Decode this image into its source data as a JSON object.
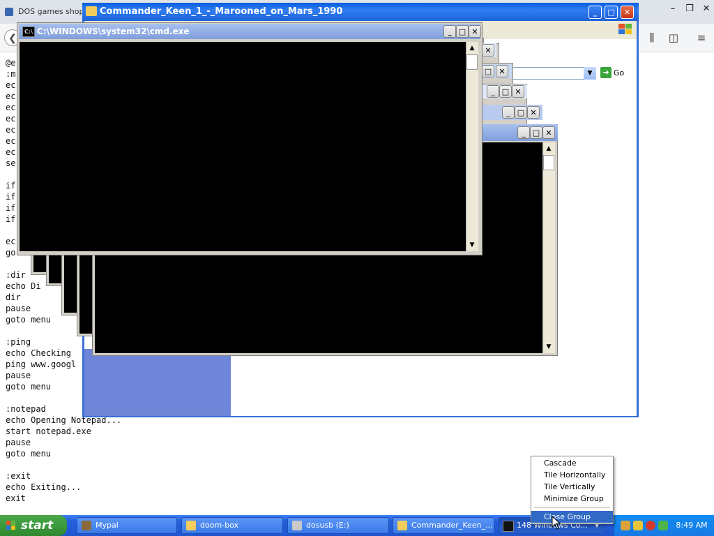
{
  "browser": {
    "tab_title": "DOS games shop",
    "controls": [
      "–",
      "❐",
      "✕"
    ],
    "back_icon": "back-arrow-icon"
  },
  "script_lines": "@e\n:m\nec\nec\nec\nec\nec\nec\nec\nse\n\nif\nif\nif\nif\n\nec\ngo\n\n:dir\necho Di\ndir\npause\ngoto menu\n\n:ping\necho Checking\nping www.googl\npause\ngoto menu\n\n:notepad\necho Opening Notepad...\nstart notepad.exe\npause\ngoto menu\n\n:exit\necho Exiting...\nexit",
  "explorer": {
    "title": "Commander_Keen_1_-_Marooned_on_Mars_1990",
    "go_label": "Go"
  },
  "cmd": {
    "title": "C:\\WINDOWS\\system32\\cmd.exe"
  },
  "taskbar": {
    "start_label": "start",
    "tasks": [
      {
        "label": "Mypal",
        "icon": "mypal-icon",
        "color": "#8a6a3a"
      },
      {
        "label": "doom-box",
        "icon": "folder-icon",
        "color": "#f2cd5c"
      },
      {
        "label": "dosusb (E:)",
        "icon": "drive-icon",
        "color": "#c9c9c9"
      },
      {
        "label": "Commander_Keen_...",
        "icon": "folder-icon",
        "color": "#f2cd5c"
      },
      {
        "label": "148 Windows Co...",
        "icon": "cmd-icon",
        "color": "#111111"
      }
    ],
    "clock": "8:49 AM"
  },
  "context_menu": {
    "items": [
      "Cascade",
      "Tile Horizontally",
      "Tile Vertically",
      "Minimize Group",
      "Close Group"
    ],
    "selected": "Close Group"
  },
  "colors": {
    "xp_title_blue": "#1d63d8",
    "taskbar_blue": "#245edb",
    "start_green": "#2f8a2f",
    "menu_highlight": "#316ac5"
  }
}
